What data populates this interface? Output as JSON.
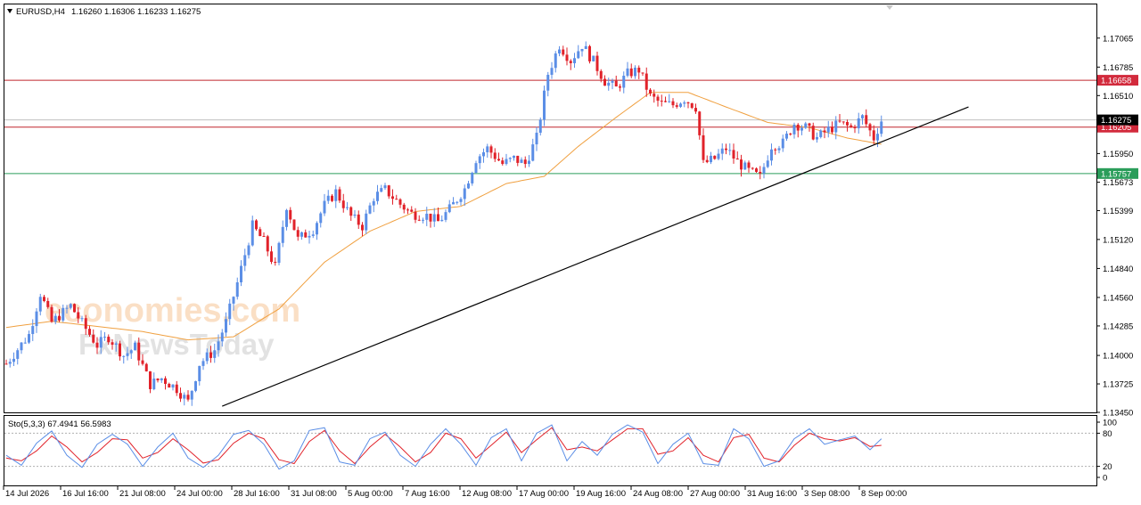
{
  "header": {
    "collapse_icon": "triangle-down-icon",
    "symbol": "EURUSD,H4",
    "ohlc": "1.16260 1.16306 1.16233 1.16275"
  },
  "price_axis": {
    "ticks": [
      "1.17065",
      "1.16785",
      "1.16510",
      "1.16235",
      "1.15950",
      "1.15673",
      "1.15399",
      "1.15120",
      "1.14840",
      "1.14560",
      "1.14285",
      "1.14000",
      "1.13725",
      "1.13450"
    ],
    "ylim": [
      1.1345,
      1.1739
    ]
  },
  "levels": [
    {
      "label": "1.16658",
      "value": 1.16658,
      "color": "#d22a3c",
      "line": "#c0272d"
    },
    {
      "label": "1.16205",
      "value": 1.16205,
      "color": "#d22a3c",
      "line": "#c0272d"
    },
    {
      "label": "1.15757",
      "value": 1.15757,
      "color": "#2a9d5a",
      "line": "#2a9d5a"
    }
  ],
  "current_price": {
    "label": "1.16275",
    "value": 1.16275
  },
  "colors": {
    "bull": "#5b8ee6",
    "bear": "#e1222a",
    "ma": "#f0a040",
    "stoch_main": "#5b8ee6",
    "stoch_signal": "#e1222a",
    "trendline": "#000000"
  },
  "watermark": {
    "line1": "economies.com",
    "line2": "FxNewsToday"
  },
  "time_axis": [
    "14 Jul 2026",
    "16 Jul 16:00",
    "21 Jul 08:00",
    "24 Jul 00:00",
    "28 Jul 16:00",
    "31 Jul 08:00",
    "5 Aug 00:00",
    "7 Aug 16:00",
    "12 Aug 08:00",
    "17 Aug 00:00",
    "19 Aug 16:00",
    "24 Aug 08:00",
    "27 Aug 00:00",
    "31 Aug 16:00",
    "3 Sep 08:00",
    "8 Sep 00:00"
  ],
  "stochastic": {
    "label": "Sto(5,3,3) 67.4941 56.5983",
    "ticks": [
      "100",
      "80",
      "20",
      "0"
    ],
    "levels": [
      80,
      20
    ]
  },
  "chart_data": {
    "type": "candlestick",
    "symbol": "EURUSD",
    "timeframe": "H4",
    "series": [
      {
        "name": "EURUSD",
        "close_path": [
          [
            0,
            1.1392
          ],
          [
            6,
            1.142
          ],
          [
            9,
            1.146
          ],
          [
            12,
            1.1432
          ],
          [
            17,
            1.1448
          ],
          [
            20,
            1.1431
          ],
          [
            24,
            1.141
          ],
          [
            27,
            1.1418
          ],
          [
            31,
            1.14
          ],
          [
            34,
            1.1408
          ],
          [
            38,
            1.1372
          ],
          [
            41,
            1.1378
          ],
          [
            45,
            1.1368
          ],
          [
            48,
            1.1355
          ],
          [
            51,
            1.1392
          ],
          [
            55,
            1.1405
          ],
          [
            58,
            1.1432
          ],
          [
            61,
            1.147
          ],
          [
            65,
            1.1525
          ],
          [
            68,
            1.151
          ],
          [
            71,
            1.1485
          ],
          [
            74,
            1.1545
          ],
          [
            77,
            1.1512
          ],
          [
            81,
            1.1522
          ],
          [
            84,
            1.1545
          ],
          [
            87,
            1.1558
          ],
          [
            91,
            1.1534
          ],
          [
            94,
            1.1525
          ],
          [
            97,
            1.1553
          ],
          [
            100,
            1.156
          ],
          [
            104,
            1.1546
          ],
          [
            107,
            1.1537
          ],
          [
            111,
            1.1535
          ],
          [
            114,
            1.1529
          ],
          [
            117,
            1.1541
          ],
          [
            121,
            1.1561
          ],
          [
            124,
            1.159
          ],
          [
            127,
            1.16
          ],
          [
            131,
            1.1585
          ],
          [
            134,
            1.159
          ],
          [
            137,
            1.1585
          ],
          [
            140,
            1.161
          ],
          [
            143,
            1.1672
          ],
          [
            146,
            1.17
          ],
          [
            149,
            1.1685
          ],
          [
            152,
            1.17
          ],
          [
            155,
            1.1684
          ],
          [
            158,
            1.1665
          ],
          [
            161,
            1.1658
          ],
          [
            164,
            1.1672
          ],
          [
            167,
            1.1676
          ],
          [
            170,
            1.165
          ],
          [
            173,
            1.1643
          ],
          [
            176,
            1.1642
          ],
          [
            179,
            1.1648
          ],
          [
            182,
            1.164
          ],
          [
            184,
            1.1585
          ],
          [
            187,
            1.159
          ],
          [
            190,
            1.16
          ],
          [
            193,
            1.1587
          ],
          [
            196,
            1.1578
          ],
          [
            199,
            1.1572
          ],
          [
            202,
            1.1603
          ],
          [
            205,
            1.1605
          ],
          [
            208,
            1.1624
          ],
          [
            211,
            1.162
          ],
          [
            214,
            1.161
          ],
          [
            217,
            1.1618
          ],
          [
            220,
            1.1624
          ],
          [
            223,
            1.162
          ],
          [
            226,
            1.163
          ],
          [
            229,
            1.161
          ],
          [
            231,
            1.1627
          ]
        ]
      }
    ],
    "moving_average": [
      [
        0,
        1.1427
      ],
      [
        12,
        1.1433
      ],
      [
        24,
        1.1428
      ],
      [
        36,
        1.1423
      ],
      [
        48,
        1.1415
      ],
      [
        60,
        1.1418
      ],
      [
        72,
        1.1445
      ],
      [
        84,
        1.149
      ],
      [
        96,
        1.152
      ],
      [
        108,
        1.1539
      ],
      [
        120,
        1.1544
      ],
      [
        132,
        1.1566
      ],
      [
        142,
        1.1573
      ],
      [
        151,
        1.1602
      ],
      [
        161,
        1.163
      ],
      [
        170,
        1.1654
      ],
      [
        180,
        1.1654
      ],
      [
        190,
        1.164
      ],
      [
        201,
        1.1625
      ],
      [
        212,
        1.162
      ],
      [
        222,
        1.161
      ],
      [
        231,
        1.1604
      ]
    ],
    "trendline": {
      "from": [
        57,
        1.1351
      ],
      "to": [
        254,
        1.164
      ]
    },
    "stochastic_main": [
      [
        0,
        40
      ],
      [
        4,
        22
      ],
      [
        8,
        62
      ],
      [
        12,
        84
      ],
      [
        16,
        40
      ],
      [
        20,
        18
      ],
      [
        24,
        60
      ],
      [
        28,
        78
      ],
      [
        32,
        60
      ],
      [
        36,
        20
      ],
      [
        40,
        55
      ],
      [
        44,
        80
      ],
      [
        48,
        35
      ],
      [
        52,
        18
      ],
      [
        56,
        40
      ],
      [
        60,
        78
      ],
      [
        64,
        85
      ],
      [
        68,
        60
      ],
      [
        72,
        15
      ],
      [
        76,
        30
      ],
      [
        80,
        85
      ],
      [
        84,
        90
      ],
      [
        88,
        28
      ],
      [
        92,
        22
      ],
      [
        96,
        70
      ],
      [
        100,
        82
      ],
      [
        104,
        40
      ],
      [
        108,
        20
      ],
      [
        112,
        60
      ],
      [
        116,
        88
      ],
      [
        120,
        60
      ],
      [
        124,
        22
      ],
      [
        128,
        72
      ],
      [
        132,
        88
      ],
      [
        136,
        30
      ],
      [
        140,
        80
      ],
      [
        144,
        95
      ],
      [
        148,
        30
      ],
      [
        152,
        65
      ],
      [
        156,
        40
      ],
      [
        160,
        78
      ],
      [
        164,
        95
      ],
      [
        168,
        82
      ],
      [
        172,
        25
      ],
      [
        176,
        60
      ],
      [
        180,
        80
      ],
      [
        184,
        25
      ],
      [
        188,
        22
      ],
      [
        192,
        88
      ],
      [
        196,
        70
      ],
      [
        200,
        20
      ],
      [
        204,
        30
      ],
      [
        208,
        70
      ],
      [
        212,
        88
      ],
      [
        216,
        60
      ],
      [
        220,
        68
      ],
      [
        224,
        75
      ],
      [
        228,
        50
      ],
      [
        231,
        70
      ]
    ],
    "stochastic_signal": [
      [
        0,
        35
      ],
      [
        4,
        30
      ],
      [
        8,
        48
      ],
      [
        12,
        75
      ],
      [
        16,
        55
      ],
      [
        20,
        28
      ],
      [
        24,
        45
      ],
      [
        28,
        70
      ],
      [
        32,
        68
      ],
      [
        36,
        35
      ],
      [
        40,
        45
      ],
      [
        44,
        70
      ],
      [
        48,
        50
      ],
      [
        52,
        26
      ],
      [
        56,
        32
      ],
      [
        60,
        62
      ],
      [
        64,
        80
      ],
      [
        68,
        70
      ],
      [
        72,
        32
      ],
      [
        76,
        25
      ],
      [
        80,
        65
      ],
      [
        84,
        85
      ],
      [
        88,
        48
      ],
      [
        92,
        25
      ],
      [
        96,
        55
      ],
      [
        100,
        78
      ],
      [
        104,
        55
      ],
      [
        108,
        28
      ],
      [
        112,
        45
      ],
      [
        116,
        80
      ],
      [
        120,
        70
      ],
      [
        124,
        35
      ],
      [
        128,
        58
      ],
      [
        132,
        82
      ],
      [
        136,
        45
      ],
      [
        140,
        68
      ],
      [
        144,
        90
      ],
      [
        148,
        50
      ],
      [
        152,
        55
      ],
      [
        156,
        48
      ],
      [
        160,
        68
      ],
      [
        164,
        88
      ],
      [
        168,
        88
      ],
      [
        172,
        42
      ],
      [
        176,
        48
      ],
      [
        180,
        72
      ],
      [
        184,
        40
      ],
      [
        188,
        28
      ],
      [
        192,
        72
      ],
      [
        196,
        78
      ],
      [
        200,
        35
      ],
      [
        204,
        28
      ],
      [
        208,
        58
      ],
      [
        212,
        80
      ],
      [
        216,
        70
      ],
      [
        220,
        66
      ],
      [
        224,
        72
      ],
      [
        228,
        56
      ],
      [
        231,
        58
      ]
    ]
  }
}
